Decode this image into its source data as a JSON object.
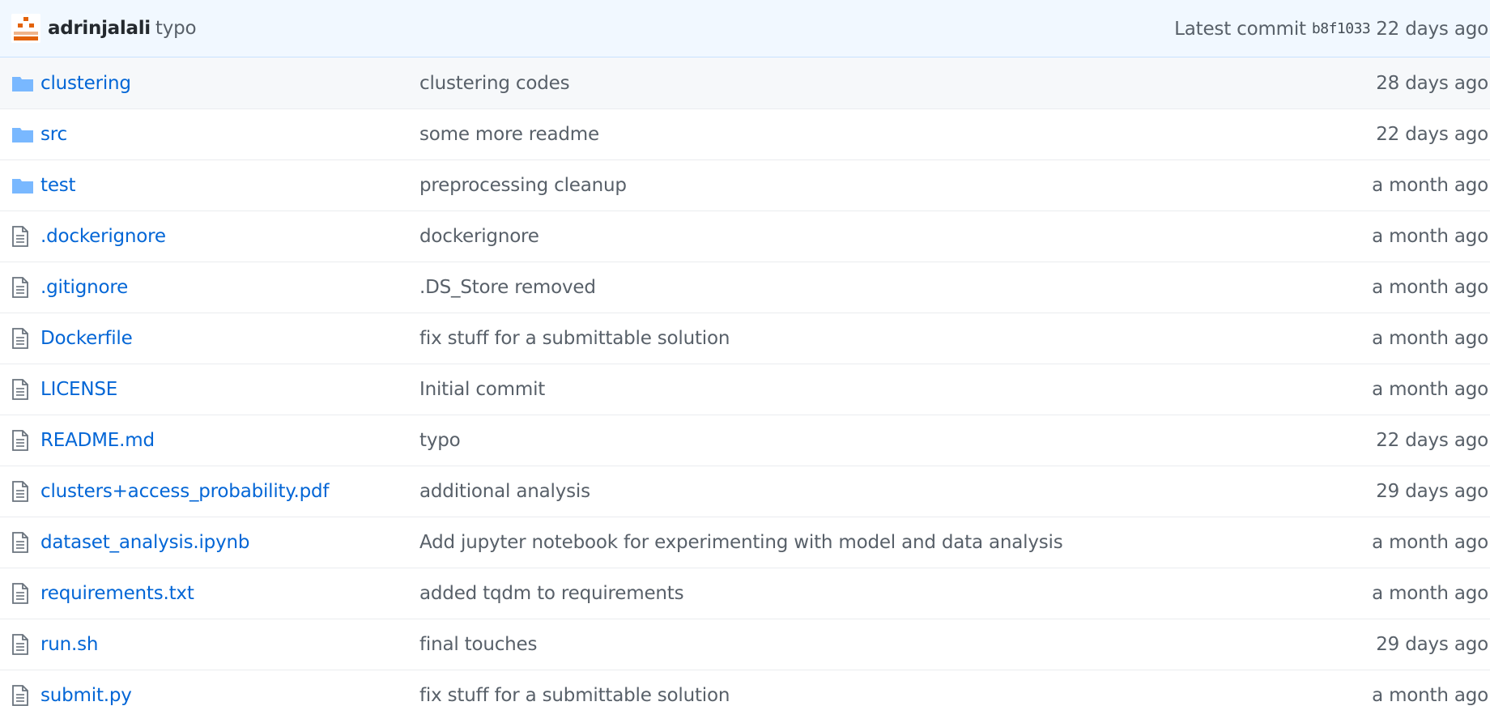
{
  "commit": {
    "author": "adrinjalali",
    "message": "typo",
    "latest_label": "Latest commit",
    "sha": "b8f1033",
    "age": "22 days ago"
  },
  "files": [
    {
      "type": "directory",
      "icon": "folder-icon",
      "name": "clustering",
      "message": "clustering codes",
      "age": "28 days ago"
    },
    {
      "type": "directory",
      "icon": "folder-icon",
      "name": "src",
      "message": "some more readme",
      "age": "22 days ago"
    },
    {
      "type": "directory",
      "icon": "folder-icon",
      "name": "test",
      "message": "preprocessing cleanup",
      "age": "a month ago"
    },
    {
      "type": "file",
      "icon": "file-icon",
      "name": ".dockerignore",
      "message": "dockerignore",
      "age": "a month ago"
    },
    {
      "type": "file",
      "icon": "file-icon",
      "name": ".gitignore",
      "message": ".DS_Store removed",
      "age": "a month ago"
    },
    {
      "type": "file",
      "icon": "file-icon",
      "name": "Dockerfile",
      "message": "fix stuff for a submittable solution",
      "age": "a month ago"
    },
    {
      "type": "file",
      "icon": "file-icon",
      "name": "LICENSE",
      "message": "Initial commit",
      "age": "a month ago"
    },
    {
      "type": "file",
      "icon": "file-icon",
      "name": "README.md",
      "message": "typo",
      "age": "22 days ago"
    },
    {
      "type": "file",
      "icon": "file-icon",
      "name": "clusters+access_probability.pdf",
      "message": "additional analysis",
      "age": "29 days ago"
    },
    {
      "type": "file",
      "icon": "file-icon",
      "name": "dataset_analysis.ipynb",
      "message": "Add jupyter notebook for experimenting with model and data analysis",
      "age": "a month ago"
    },
    {
      "type": "file",
      "icon": "file-icon",
      "name": "requirements.txt",
      "message": "added tqdm to requirements",
      "age": "a month ago"
    },
    {
      "type": "file",
      "icon": "file-icon",
      "name": "run.sh",
      "message": "final touches",
      "age": "29 days ago"
    },
    {
      "type": "file",
      "icon": "file-icon",
      "name": "submit.py",
      "message": "fix stuff for a submittable solution",
      "age": "a month ago"
    }
  ],
  "colors": {
    "link": "#0366d6",
    "muted": "#586069",
    "header_bg": "#f1f8ff",
    "folder_icon": "#79b8ff",
    "file_icon": "#6a737d",
    "avatar_accent": "#e36209"
  }
}
